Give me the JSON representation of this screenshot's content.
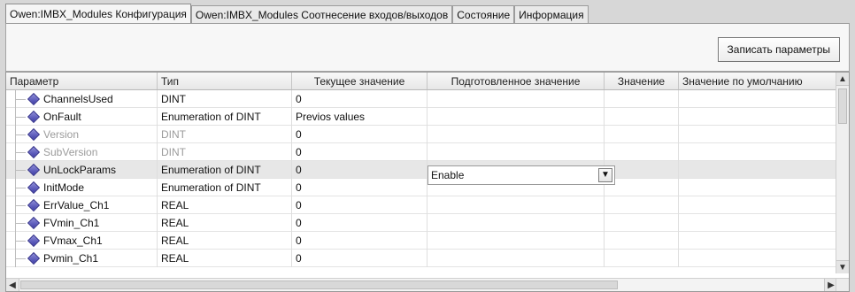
{
  "tabs": [
    {
      "label": "Owen:IMBX_Modules Конфигурация",
      "active": true
    },
    {
      "label": "Owen:IMBX_Modules Соотнесение входов/выходов",
      "active": false
    },
    {
      "label": "Состояние",
      "active": false
    },
    {
      "label": "Информация",
      "active": false
    }
  ],
  "toolbar": {
    "write_params": "Записать параметры"
  },
  "table": {
    "headers": [
      "Параметр",
      "Тип",
      "Текущее значение",
      "Подготовленное значение",
      "Значение",
      "Значение по умолчанию"
    ],
    "rows": [
      {
        "parameter": "ChannelsUsed",
        "type": "DINT",
        "current": "0",
        "prepared": "",
        "value": "",
        "default": "",
        "muted": false
      },
      {
        "parameter": "OnFault",
        "type": "Enumeration of DINT",
        "current": "Previos values",
        "prepared": "",
        "value": "",
        "default": "",
        "muted": false
      },
      {
        "parameter": "Version",
        "type": "DINT",
        "current": "0",
        "prepared": "",
        "value": "",
        "default": "",
        "muted": true
      },
      {
        "parameter": "SubVersion",
        "type": "DINT",
        "current": "0",
        "prepared": "",
        "value": "",
        "default": "",
        "muted": true
      },
      {
        "parameter": "UnLockParams",
        "type": "Enumeration of DINT",
        "current": "0",
        "prepared": "Enable",
        "value": "",
        "default": "",
        "muted": false,
        "selected": true
      },
      {
        "parameter": "InitMode",
        "type": "Enumeration of DINT",
        "current": "0",
        "prepared": "",
        "value": "",
        "default": "",
        "muted": false
      },
      {
        "parameter": "ErrValue_Ch1",
        "type": "REAL",
        "current": "0",
        "prepared": "",
        "value": "",
        "default": "",
        "muted": false
      },
      {
        "parameter": "FVmin_Ch1",
        "type": "REAL",
        "current": "0",
        "prepared": "",
        "value": "",
        "default": "",
        "muted": false
      },
      {
        "parameter": "FVmax_Ch1",
        "type": "REAL",
        "current": "0",
        "prepared": "",
        "value": "",
        "default": "",
        "muted": false
      },
      {
        "parameter": "Pvmin_Ch1",
        "type": "REAL",
        "current": "0",
        "prepared": "",
        "value": "",
        "default": "",
        "muted": false
      }
    ]
  },
  "dropdown": {
    "selected": "Enable",
    "arrow_icon": "dropdown-arrow-icon"
  },
  "scrollbars": {
    "up_icon": "scroll-up-icon",
    "down_icon": "scroll-down-icon",
    "left_icon": "scroll-left-icon",
    "right_icon": "scroll-right-icon"
  }
}
